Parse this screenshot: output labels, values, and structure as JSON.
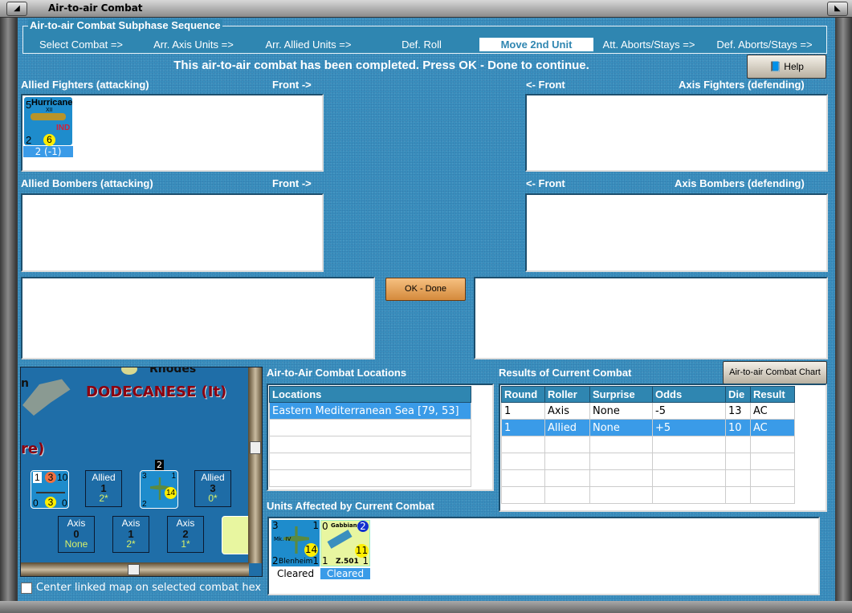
{
  "window": {
    "title": "Air-to-air Combat"
  },
  "sequence": {
    "legend": "Air-to-air Combat Subphase Sequence",
    "steps": [
      "Select Combat =>",
      "Arr. Axis Units =>",
      "Arr. Allied Units =>",
      "Def. Roll",
      "Move 2nd Unit",
      "Att. Aborts/Stays =>",
      "Def. Aborts/Stays =>"
    ],
    "selected": "Move 2nd Unit"
  },
  "message": "This air-to-air combat has been completed.  Press OK - Done to continue.",
  "help_label": "Help",
  "panels": {
    "allied_fighters": "Allied Fighters (attacking)",
    "axis_fighters": "Axis Fighters (defending)",
    "allied_bombers": "Allied Bombers (attacking)",
    "axis_bombers": "Axis Bombers (defending)",
    "front_right": "Front ->",
    "front_left": "<- Front"
  },
  "allied_fighter_unit": {
    "name": "Hurricane",
    "variant": "XII",
    "nation": "IND",
    "attack": "5",
    "defense": "2",
    "range": "6",
    "footer": "2 (-1)"
  },
  "ok_label": "OK - Done",
  "map": {
    "region": "DODECANESE (It)",
    "island": "Rhodes",
    "partial_left": "n",
    "partial_label": "re)",
    "slots": [
      {
        "side": "Allied",
        "num": "1",
        "val": "2*"
      },
      {
        "side": "Allied",
        "num": "3",
        "val": "0*"
      },
      {
        "side": "Axis",
        "num": "0",
        "val": "None"
      },
      {
        "side": "Axis",
        "num": "1",
        "val": "2*"
      },
      {
        "side": "Axis",
        "num": "2",
        "val": "1*"
      }
    ],
    "stack_count": "2"
  },
  "center_checkbox": {
    "label": "Center linked map on selected combat hex",
    "checked": false
  },
  "locations": {
    "title": "Air-to-Air Combat Locations",
    "header": "Locations",
    "rows": [
      "Eastern Mediterranean Sea [79, 53]"
    ]
  },
  "results": {
    "title": "Results of Current Combat",
    "chart_button": "Air-to-air Combat Chart",
    "columns": [
      "Round",
      "Roller",
      "Surprise",
      "Odds",
      "Die",
      "Result"
    ],
    "rows": [
      [
        "1",
        "Axis",
        "None",
        "-5",
        "13",
        "AC"
      ],
      [
        "1",
        "Allied",
        "None",
        "+5",
        "10",
        "AC"
      ]
    ],
    "selected_row": 1
  },
  "affected": {
    "title": "Units Affected by Current Combat",
    "units": [
      {
        "name": "Blenheim",
        "variant": "Mk. IV",
        "tl": "3",
        "tr": "1",
        "bl": "2",
        "br": "1",
        "range": "14",
        "status": "Cleared",
        "bg": "#1e8ccc"
      },
      {
        "name": "Z.501",
        "top": "Gabbiano",
        "tl": "0",
        "badge": "2",
        "bl": "1",
        "br": "1",
        "range": "11",
        "status": "Cleared",
        "bg": "#e8f6a0"
      }
    ]
  },
  "colors": {
    "panel_blue": "#3a8fbe",
    "header_blue": "#2f86b1",
    "selection": "#3a9be8",
    "region_label": "#8b0010"
  }
}
